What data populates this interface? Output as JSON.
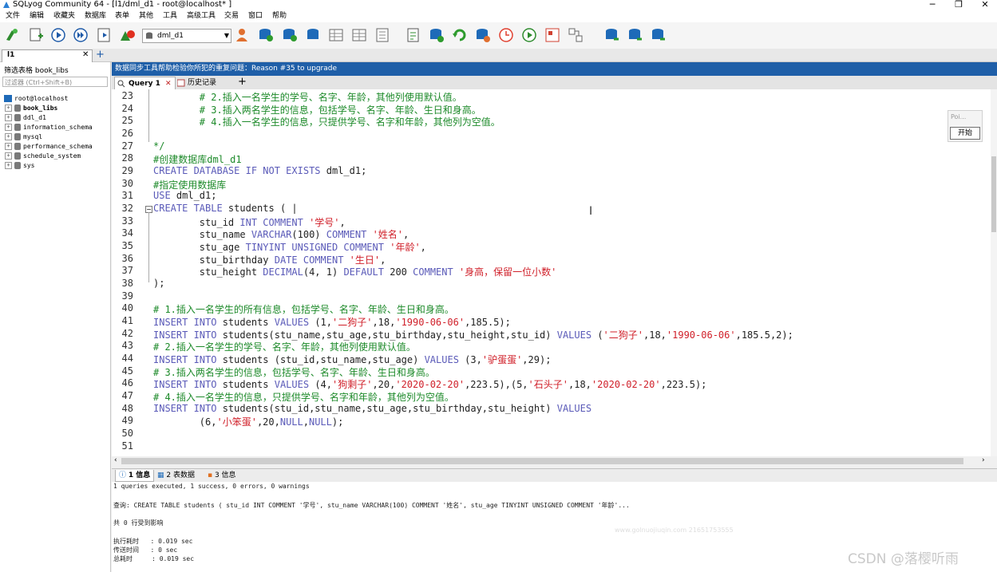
{
  "window": {
    "title": "SQLyog Community 64 - [l1/dml_d1 - root@localhost* ]"
  },
  "menu": [
    "文件",
    "编辑",
    "收藏夹",
    "数据库",
    "表单",
    "其他",
    "工具",
    "高级工具",
    "交易",
    "窗口",
    "帮助"
  ],
  "toolbar": {
    "database_selected": "dml_d1"
  },
  "connection_tab": {
    "label": "l1"
  },
  "left_panel": {
    "header": "筛选表格 book_libs",
    "filter_placeholder": "过滤器 (Ctrl+Shift+B)",
    "root": "root@localhost",
    "databases": [
      "book_libs",
      "ddl_d1",
      "information_schema",
      "mysql",
      "performance_schema",
      "schedule_system",
      "sys"
    ]
  },
  "notice": "数据同步工具帮助检验你所犯的重复问题：Reason #35 to upgrade",
  "query_tabs": [
    "Query 1",
    "历史记录"
  ],
  "editor": {
    "lines": [
      {
        "n": 23,
        "segs": [
          [
            "cm",
            "        # 2.插入一名学生的学号、名字、年龄，其他列使用默认值。"
          ]
        ]
      },
      {
        "n": 24,
        "segs": [
          [
            "cm",
            "        # 3.插入两名学生的信息，包括学号、名字、年龄、生日和身高。"
          ]
        ]
      },
      {
        "n": 25,
        "segs": [
          [
            "cm",
            "        # 4.插入一名学生的信息，只提供学号、名字和年龄，其他列为空值。"
          ]
        ]
      },
      {
        "n": 26,
        "segs": []
      },
      {
        "n": 27,
        "segs": [
          [
            "cm",
            "*/"
          ]
        ]
      },
      {
        "n": 28,
        "segs": [
          [
            "cm",
            "#创建数据库dml_d1"
          ]
        ]
      },
      {
        "n": 29,
        "segs": [
          [
            "kw",
            "CREATE DATABASE IF NOT EXISTS "
          ],
          [
            "id",
            "dml_d1;"
          ]
        ]
      },
      {
        "n": 30,
        "segs": [
          [
            "cm",
            "#指定使用数据库"
          ]
        ]
      },
      {
        "n": 31,
        "segs": [
          [
            "kw",
            "USE "
          ],
          [
            "id",
            "dml_d1;"
          ]
        ]
      },
      {
        "n": 32,
        "segs": [
          [
            "kw",
            "CREATE TABLE "
          ],
          [
            "id",
            "students ( |"
          ]
        ]
      },
      {
        "n": 33,
        "segs": [
          [
            "id",
            "        stu_id "
          ],
          [
            "kw",
            "INT COMMENT "
          ],
          [
            "str",
            "'学号'"
          ],
          [
            "id",
            ","
          ]
        ]
      },
      {
        "n": 34,
        "segs": [
          [
            "id",
            "        stu_name "
          ],
          [
            "kw",
            "VARCHAR"
          ],
          [
            "id",
            "(100) "
          ],
          [
            "kw",
            "COMMENT "
          ],
          [
            "str",
            "'姓名'"
          ],
          [
            "id",
            ","
          ]
        ]
      },
      {
        "n": 35,
        "segs": [
          [
            "id",
            "        stu_age "
          ],
          [
            "kw",
            "TINYINT UNSIGNED COMMENT "
          ],
          [
            "str",
            "'年龄'"
          ],
          [
            "id",
            ","
          ]
        ]
      },
      {
        "n": 36,
        "segs": [
          [
            "id",
            "        stu_birthday "
          ],
          [
            "kw",
            "DATE COMMENT "
          ],
          [
            "str",
            "'生日'"
          ],
          [
            "id",
            ","
          ]
        ]
      },
      {
        "n": 37,
        "segs": [
          [
            "id",
            "        stu_height "
          ],
          [
            "kw",
            "DECIMAL"
          ],
          [
            "id",
            "(4, 1) "
          ],
          [
            "kw",
            "DEFAULT "
          ],
          [
            "id",
            "200 "
          ],
          [
            "kw",
            "COMMENT "
          ],
          [
            "str",
            "'身高，保留一位小数'"
          ]
        ]
      },
      {
        "n": 38,
        "segs": [
          [
            "id",
            ");"
          ]
        ]
      },
      {
        "n": 39,
        "segs": []
      },
      {
        "n": 40,
        "segs": [
          [
            "cm",
            "# 1.插入一名学生的所有信息，包括学号、名字、年龄、生日和身高。"
          ]
        ]
      },
      {
        "n": 41,
        "segs": [
          [
            "kw",
            "INSERT INTO "
          ],
          [
            "id",
            "students "
          ],
          [
            "kw",
            "VALUES "
          ],
          [
            "id",
            "(1,"
          ],
          [
            "str",
            "'二狗子'"
          ],
          [
            "id",
            ",18,"
          ],
          [
            "str",
            "'1990-06-06'"
          ],
          [
            "id",
            ",185.5);"
          ]
        ]
      },
      {
        "n": 42,
        "segs": [
          [
            "kw",
            "INSERT INTO "
          ],
          [
            "id",
            "students(stu_name,stu_age,stu_birthday,stu_height,stu_id) "
          ],
          [
            "kw",
            "VALUES "
          ],
          [
            "id",
            "("
          ],
          [
            "str",
            "'二狗子'"
          ],
          [
            "id",
            ",18,"
          ],
          [
            "str",
            "'1990-06-06'"
          ],
          [
            "id",
            ",185.5,2);"
          ]
        ]
      },
      {
        "n": 43,
        "segs": [
          [
            "cm",
            "# 2.插入一名学生的学号、名字、年龄，其他列使用默认值。"
          ]
        ]
      },
      {
        "n": 44,
        "segs": [
          [
            "kw",
            "INSERT INTO "
          ],
          [
            "id",
            "students (stu_id,stu_name,stu_age) "
          ],
          [
            "kw",
            "VALUES "
          ],
          [
            "id",
            "(3,"
          ],
          [
            "str",
            "'驴蛋蛋'"
          ],
          [
            "id",
            ",29);"
          ]
        ]
      },
      {
        "n": 45,
        "segs": [
          [
            "cm",
            "# 3.插入两名学生的信息，包括学号、名字、年龄、生日和身高。"
          ]
        ]
      },
      {
        "n": 46,
        "segs": [
          [
            "kw",
            "INSERT INTO "
          ],
          [
            "id",
            "students "
          ],
          [
            "kw",
            "VALUES "
          ],
          [
            "id",
            "(4,"
          ],
          [
            "str",
            "'狗剩子'"
          ],
          [
            "id",
            ",20,"
          ],
          [
            "str",
            "'2020-02-20'"
          ],
          [
            "id",
            ",223.5),(5,"
          ],
          [
            "str",
            "'石头子'"
          ],
          [
            "id",
            ",18,"
          ],
          [
            "str",
            "'2020-02-20'"
          ],
          [
            "id",
            ",223.5);"
          ]
        ]
      },
      {
        "n": 47,
        "segs": [
          [
            "cm",
            "# 4.插入一名学生的信息，只提供学号、名字和年龄，其他列为空值。"
          ]
        ]
      },
      {
        "n": 48,
        "segs": [
          [
            "kw",
            "INSERT INTO "
          ],
          [
            "id",
            "students(stu_id,stu_name,stu_age,stu_birthday,stu_height) "
          ],
          [
            "kw",
            "VALUES"
          ]
        ]
      },
      {
        "n": 49,
        "segs": [
          [
            "id",
            "        (6,"
          ],
          [
            "str",
            "'小笨蛋'"
          ],
          [
            "id",
            ",20,"
          ],
          [
            "kw",
            "NULL"
          ],
          [
            "id",
            ","
          ],
          [
            "kw",
            "NULL"
          ],
          [
            "id",
            ");"
          ]
        ]
      },
      {
        "n": 50,
        "segs": []
      },
      {
        "n": 51,
        "segs": []
      }
    ]
  },
  "result_tabs": [
    "1 信息",
    "2 表数据",
    "3 信息"
  ],
  "output": {
    "summary": "1 queries executed, 1 success, 0 errors, 0 warnings",
    "query": "查询: CREATE TABLE students ( stu_id INT COMMENT '学号', stu_name VARCHAR(100) COMMENT '姓名', stu_age TINYINT UNSIGNED COMMENT '年龄'...",
    "affected": "共 0 行受到影响",
    "exec_time": "执行耗时   : 0.019 sec",
    "transfer_time": "传送时间   : 0 sec",
    "total_time": "总耗时     : 0.019 sec"
  },
  "widget": {
    "label": "Poi...",
    "button": "开始"
  },
  "watermark": "CSDN @落樱听雨",
  "watermark_small": "www.golnuojiuqin.com 21651753555"
}
